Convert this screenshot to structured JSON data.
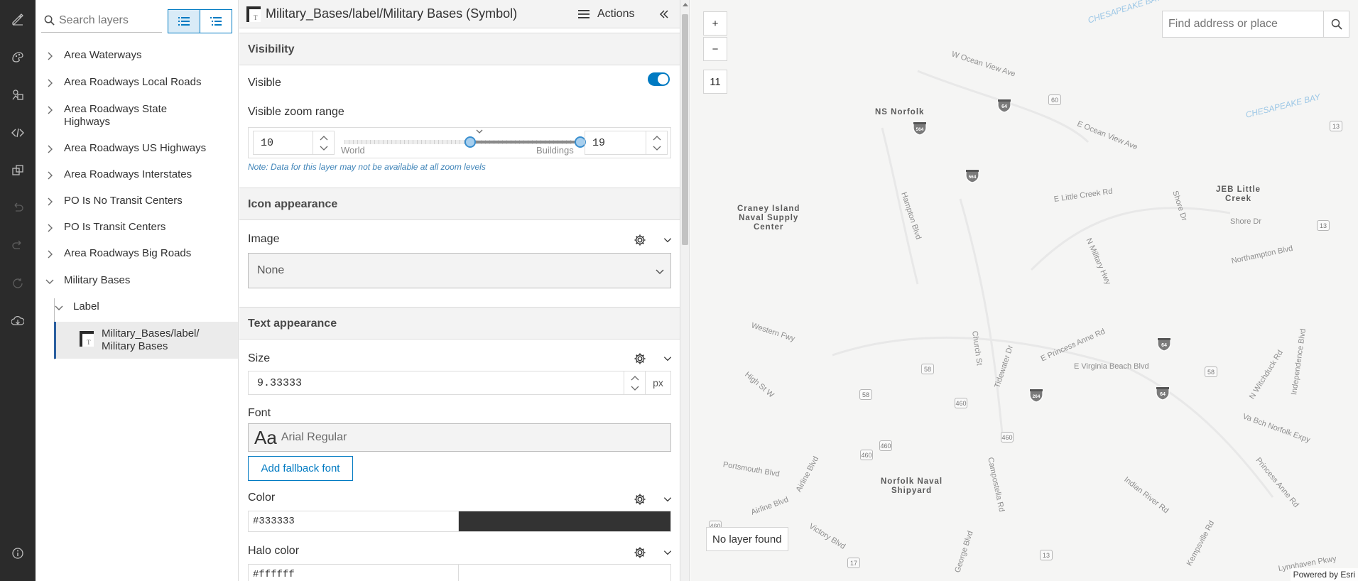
{
  "layers_panel": {
    "search_placeholder": "Search layers",
    "items": [
      {
        "label": "Area Waterways"
      },
      {
        "label": "Area Roadways Local Roads"
      },
      {
        "label": "Area Roadways State Highways"
      },
      {
        "label": "Area Roadways US Highways"
      },
      {
        "label": "Area Roadways Interstates"
      },
      {
        "label": "PO Is No Transit Centers"
      },
      {
        "label": "PO Is Transit Centers"
      },
      {
        "label": "Area Roadways Big Roads"
      },
      {
        "label": "Military Bases"
      },
      {
        "label": "Label"
      }
    ],
    "selected_symbol_label": "Military_Bases/label/ Military Bases"
  },
  "props_panel": {
    "title": "Military_Bases/label/Military Bases (Symbol)",
    "actions_label": "Actions",
    "visibility": {
      "heading": "Visibility",
      "visible_label": "Visible",
      "visible_on": true,
      "zoom_range_label": "Visible zoom range",
      "min_zoom": "10",
      "max_zoom": "19",
      "world_label": "World",
      "buildings_label": "Buildings",
      "note": "Note: Data for this layer may not be available at all zoom levels"
    },
    "icon": {
      "heading": "Icon appearance",
      "image_label": "Image",
      "image_value": "None"
    },
    "text": {
      "heading": "Text appearance",
      "size_label": "Size",
      "size_value": "9.33333",
      "size_unit": "px",
      "font_label": "Font",
      "font_sample": "Aa",
      "font_name": "Arial Regular",
      "fallback_button": "Add fallback font",
      "color_label": "Color",
      "color_value": "#333333",
      "halo_label": "Halo color",
      "halo_value": "#ffffff"
    }
  },
  "map": {
    "zoom_in": "+",
    "zoom_out": "−",
    "zoom_level": "11",
    "search_placeholder": "Find address or place",
    "no_layer": "No layer found",
    "attribution": "Powered by Esri",
    "places": [
      {
        "name": "NS Norfolk"
      },
      {
        "name": "Craney Island\nNaval Supply\nCenter"
      },
      {
        "name": "JEB Little\nCreek"
      },
      {
        "name": "Norfolk Naval\nShipyard"
      }
    ],
    "waters": [
      {
        "name": "CHESAPEAKE BAY"
      },
      {
        "name": "CHESAPEAKE BAY"
      }
    ],
    "roads": [
      {
        "name": "W Ocean View Ave"
      },
      {
        "name": "E Ocean View Ave"
      },
      {
        "name": "Hampton Blvd"
      },
      {
        "name": "E Little Creek Rd"
      },
      {
        "name": "Shore Dr"
      },
      {
        "name": "Shore Dr"
      },
      {
        "name": "N Military Hwy"
      },
      {
        "name": "Northampton Blvd"
      },
      {
        "name": "Western Fwy"
      },
      {
        "name": "Church St"
      },
      {
        "name": "Tidewater Dr"
      },
      {
        "name": "E Princess Anne Rd"
      },
      {
        "name": "E Virginia Beach Blvd"
      },
      {
        "name": "N Witchduck Rd"
      },
      {
        "name": "Independence Blvd"
      },
      {
        "name": "High St W"
      },
      {
        "name": "Va Bch Norfolk Expy"
      },
      {
        "name": "Portsmouth Blvd"
      },
      {
        "name": "Airline Blvd"
      },
      {
        "name": "Airline Blvd"
      },
      {
        "name": "Campostella Rd"
      },
      {
        "name": "Princess Anne Rd"
      },
      {
        "name": "Indian River Rd"
      },
      {
        "name": "Victory Blvd"
      },
      {
        "name": "Kempsville Rd"
      },
      {
        "name": "Lynnhaven Pkwy"
      },
      {
        "name": "George Blvd"
      }
    ],
    "shields": [
      "64",
      "564",
      "564",
      "64",
      "264",
      "64"
    ],
    "routes": [
      "60",
      "13",
      "13",
      "58",
      "58",
      "58",
      "460",
      "460",
      "460",
      "460",
      "460",
      "17",
      "13"
    ]
  }
}
